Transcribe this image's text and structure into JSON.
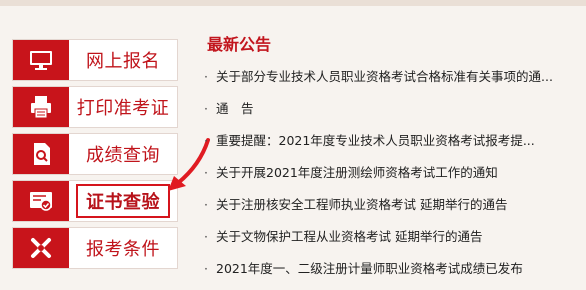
{
  "sidebar": {
    "items": [
      {
        "label": "网上报名",
        "icon": "monitor-icon"
      },
      {
        "label": "打印准考证",
        "icon": "printer-icon"
      },
      {
        "label": "成绩查询",
        "icon": "search-document-icon"
      },
      {
        "label": "证书查验",
        "icon": "certificate-check-icon",
        "active": true
      },
      {
        "label": "报考条件",
        "icon": "tools-icon"
      }
    ]
  },
  "news": {
    "title": "最新公告",
    "items": [
      "关于部分专业技术人员职业资格考试合格标准有关事项的通...",
      "通　告",
      "重要提醒：2021年度专业技术人员职业资格考试报考提...",
      "关于开展2021年度注册测绘师资格考试工作的通知",
      "关于注册核安全工程师执业资格考试 延期举行的通告",
      "关于文物保护工程从业资格考试 延期举行的通告",
      "2021年度一、二级注册计量师职业资格考试成绩已发布"
    ]
  },
  "colors": {
    "accent": "#c8141b",
    "arrow": "#e01b22",
    "background": "#f7f3ef"
  }
}
